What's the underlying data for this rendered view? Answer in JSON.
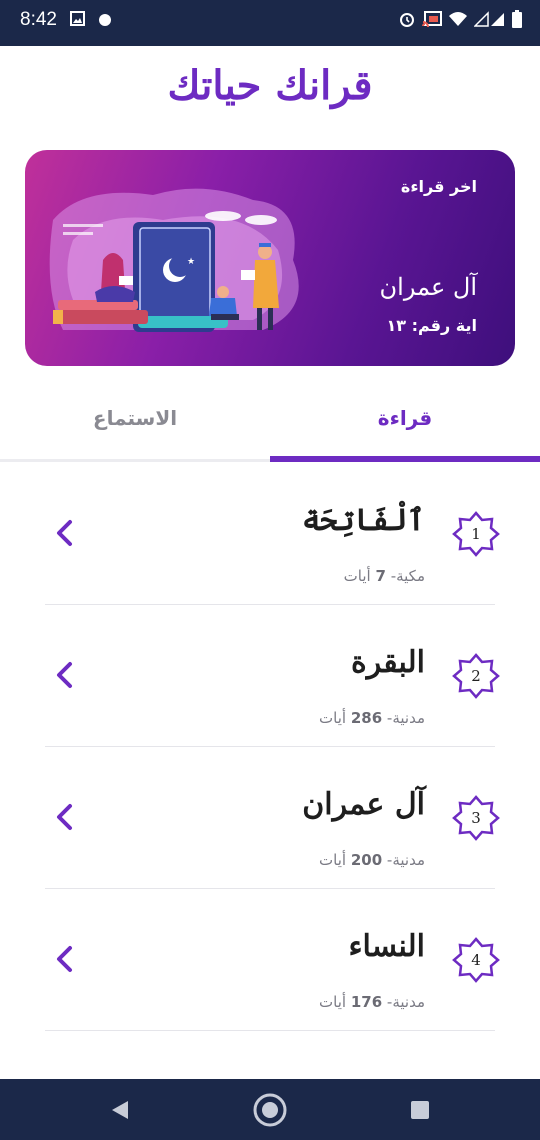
{
  "status_bar": {
    "time": "8:42",
    "left_icons": [
      "image-icon",
      "dot-icon"
    ],
    "right_icons": [
      "alarm-icon",
      "cast-icon",
      "wifi-icon",
      "signal-icon",
      "battery-icon"
    ]
  },
  "header": {
    "title": "قرانك حياتك"
  },
  "last_read": {
    "label": "اخر قراءة",
    "surah": "آل عمران",
    "ayah": "اية رقم: ١٣"
  },
  "tabs": [
    {
      "label": "قراءة",
      "selected": true
    },
    {
      "label": "الاستماع",
      "selected": false
    }
  ],
  "surahs": [
    {
      "number": "1",
      "name": "ٱلْفَاتِحَة",
      "type": "مكية",
      "ayat": "7",
      "ayat_word": "أيات"
    },
    {
      "number": "2",
      "name": "البقرة",
      "type": "مدنية",
      "ayat": "286",
      "ayat_word": "أيات"
    },
    {
      "number": "3",
      "name": "آل عمران",
      "type": "مدنية",
      "ayat": "200",
      "ayat_word": "أيات"
    },
    {
      "number": "4",
      "name": "النساء",
      "type": "مدنية",
      "ayat": "176",
      "ayat_word": "أيات"
    }
  ],
  "colors": {
    "accent": "#6d2bc2",
    "bar": "#1b2849"
  },
  "nav_bar": [
    "back-icon",
    "home-icon",
    "recents-icon"
  ]
}
